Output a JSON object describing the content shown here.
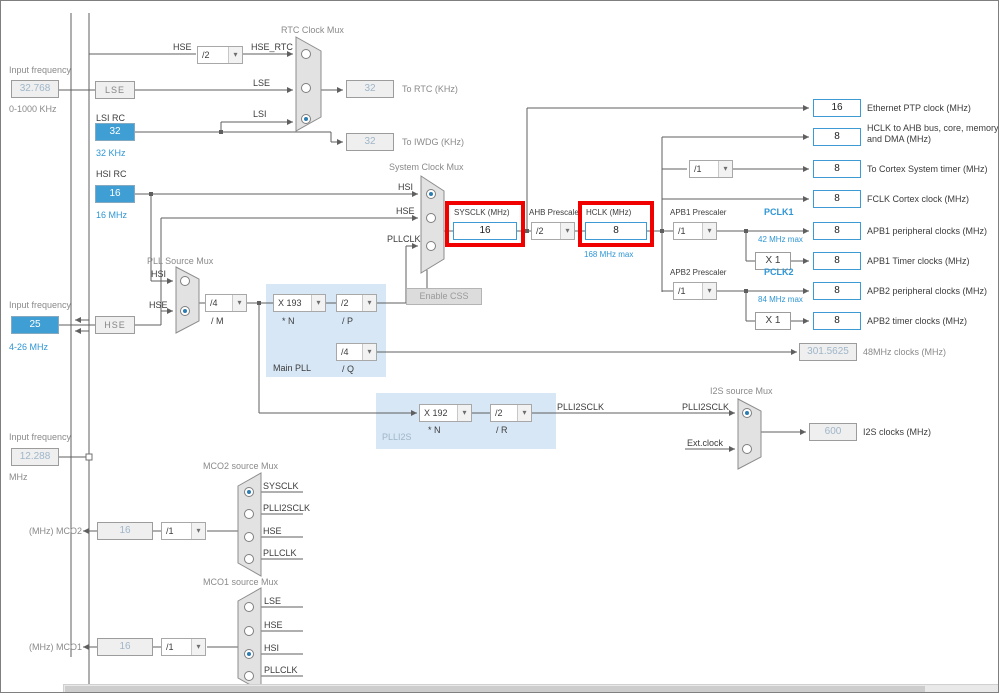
{
  "sources": {
    "lse": {
      "label": "Input frequency",
      "value": "32.768",
      "range": "0-1000 KHz",
      "name": "LSE"
    },
    "lsi": {
      "label": "LSI RC",
      "value": "32",
      "freq": "32 KHz"
    },
    "hsi": {
      "label": "HSI RC",
      "value": "16",
      "freq": "16 MHz"
    },
    "hse": {
      "label": "Input frequency",
      "value": "25",
      "range": "4-26 MHz",
      "name": "HSE"
    },
    "i2s_ckin": {
      "label": "Input frequency",
      "value": "12.288",
      "range": "MHz"
    }
  },
  "rtc": {
    "title": "RTC Clock Mux",
    "hse": "HSE",
    "div": "/2",
    "hse_rtc": "HSE_RTC",
    "lse": "LSE",
    "lsi": "LSI",
    "rtc_value": "32",
    "rtc_label": "To RTC (KHz)",
    "iwdg_value": "32",
    "iwdg_label": "To IWDG (KHz)"
  },
  "pll": {
    "title": "PLL Source Mux",
    "hsi": "HSI",
    "hse": "HSE",
    "m": "/4",
    "m_label": "/ M",
    "n": "X 193",
    "n_label": "* N",
    "p": "/2",
    "p_label": "/ P",
    "q": "/4",
    "q_label": "/ Q",
    "block": "Main PLL"
  },
  "sys": {
    "title": "System Clock Mux",
    "hsi": "HSI",
    "hse": "HSE",
    "pllclk": "PLLCLK",
    "sysclk_label": "SYSCLK (MHz)",
    "sysclk": "16",
    "ahb_label": "AHB Prescaler",
    "ahb_div": "/2",
    "hclk_label": "HCLK (MHz)",
    "hclk": "8",
    "hclk_max": "168 MHz max",
    "css_btn": "Enable CSS"
  },
  "right": {
    "eth": {
      "value": "16",
      "label": "Ethernet PTP clock (MHz)"
    },
    "ahb_bus": {
      "value": "8",
      "label": "HCLK to AHB bus, core, memory and DMA (MHz)"
    },
    "cortex": {
      "div": "/1",
      "value": "8",
      "label": "To Cortex System timer (MHz)"
    },
    "fclk": {
      "value": "8",
      "label": "FCLK Cortex clock (MHz)"
    },
    "apb1": {
      "title": "APB1 Prescaler",
      "div": "/1",
      "pclk": "PCLK1",
      "max": "42 MHz max",
      "value": "8",
      "label": "APB1 peripheral clocks (MHz)",
      "mul": "X 1",
      "timer_value": "8",
      "timer_label": "APB1 Timer clocks (MHz)"
    },
    "apb2": {
      "title": "APB2 Prescaler",
      "div": "/1",
      "pclk": "PCLK2",
      "max": "84 MHz max",
      "value": "8",
      "label": "APB2 peripheral clocks (MHz)",
      "mul": "X 1",
      "timer_value": "8",
      "timer_label": "APB2 timer clocks (MHz)"
    },
    "clk48": {
      "value": "301.5625",
      "label": "48MHz clocks (MHz)"
    }
  },
  "plli2s": {
    "block": "PLLI2S",
    "n": "X 192",
    "n_label": "* N",
    "r": "/2",
    "r_label": "/ R",
    "wire": "PLLI2SCLK",
    "mux_title": "I2S source Mux",
    "in_pll": "PLLI2SCLK",
    "in_ext": "Ext.clock",
    "value": "600",
    "label": "I2S clocks (MHz)"
  },
  "mco2": {
    "title": "MCO2 source Mux",
    "inputs": [
      "SYSCLK",
      "PLLI2SCLK",
      "HSE",
      "PLLCLK"
    ],
    "label": "(MHz) MCO2",
    "value": "16",
    "div": "/1"
  },
  "mco1": {
    "title": "MCO1 source Mux",
    "inputs": [
      "LSE",
      "HSE",
      "HSI",
      "PLLCLK"
    ],
    "label": "(MHz) MCO1",
    "value": "16",
    "div": "/1"
  }
}
